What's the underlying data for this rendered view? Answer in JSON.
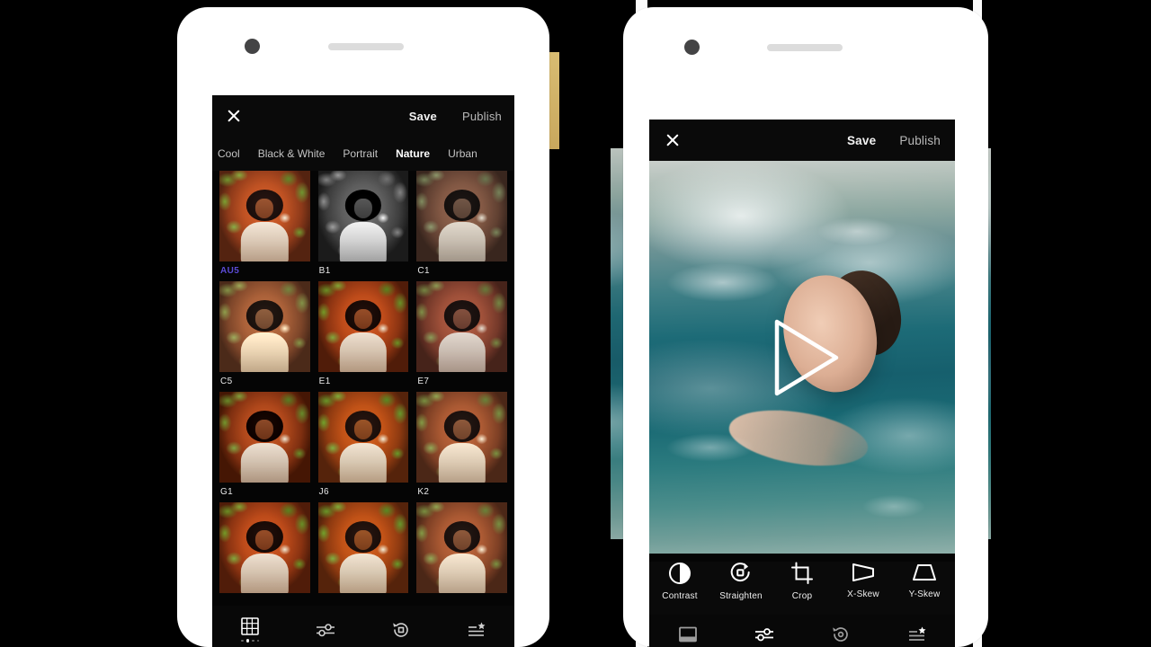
{
  "app": {
    "left_screen": {
      "appbar": {
        "close_icon": "close-icon",
        "save_label": "Save",
        "publish_label": "Publish"
      },
      "tabs": [
        {
          "label": "Cool",
          "active": false
        },
        {
          "label": "Black & White",
          "active": false
        },
        {
          "label": "Portrait",
          "active": false
        },
        {
          "label": "Nature",
          "active": true
        },
        {
          "label": "Urban",
          "active": false
        }
      ],
      "selected_filter": "AU5",
      "selected_filter_color": "#5b4bd6",
      "filters": [
        {
          "label": "AU5",
          "variant": "aus",
          "selected": true
        },
        {
          "label": "B1",
          "variant": "bw",
          "selected": false
        },
        {
          "label": "C1",
          "variant": "c1",
          "selected": false
        },
        {
          "label": "C5",
          "variant": "c5",
          "selected": false
        },
        {
          "label": "E1",
          "variant": "e1",
          "selected": false
        },
        {
          "label": "E7",
          "variant": "e7",
          "selected": false
        },
        {
          "label": "G1",
          "variant": "g1",
          "selected": false
        },
        {
          "label": "J6",
          "variant": "j6",
          "selected": false
        },
        {
          "label": "K2",
          "variant": "k2",
          "selected": false
        },
        {
          "label": "",
          "variant": "e1",
          "selected": false
        },
        {
          "label": "",
          "variant": "j6",
          "selected": false
        },
        {
          "label": "",
          "variant": "k2",
          "selected": false
        }
      ],
      "bottom_nav": [
        {
          "icon": "grid-icon",
          "active": true
        },
        {
          "icon": "sliders-icon",
          "active": false
        },
        {
          "icon": "undo-history-icon",
          "active": false
        },
        {
          "icon": "list-star-icon",
          "active": false
        }
      ]
    },
    "right_screen": {
      "appbar": {
        "close_icon": "close-icon",
        "save_label": "Save",
        "publish_label": "Publish"
      },
      "media": {
        "play_icon": "play-triangle-icon"
      },
      "tools": [
        {
          "label": "Contrast",
          "icon": "contrast-icon"
        },
        {
          "label": "Straighten",
          "icon": "straighten-icon"
        },
        {
          "label": "Crop",
          "icon": "crop-icon"
        },
        {
          "label": "X-Skew",
          "icon": "x-skew-icon"
        },
        {
          "label": "Y-Skew",
          "icon": "y-skew-icon"
        }
      ],
      "bottom_nav": [
        {
          "icon": "frame-icon",
          "active": false
        },
        {
          "icon": "sliders-icon",
          "active": true
        },
        {
          "icon": "undo-history-icon",
          "active": false
        },
        {
          "icon": "list-star-icon",
          "active": false
        }
      ]
    }
  },
  "colors": {
    "background": "#000000",
    "phone_body": "#ffffff",
    "screen_bg": "#050505",
    "accent": "#5b4bd6",
    "gold_accent": "#c9a85d"
  }
}
